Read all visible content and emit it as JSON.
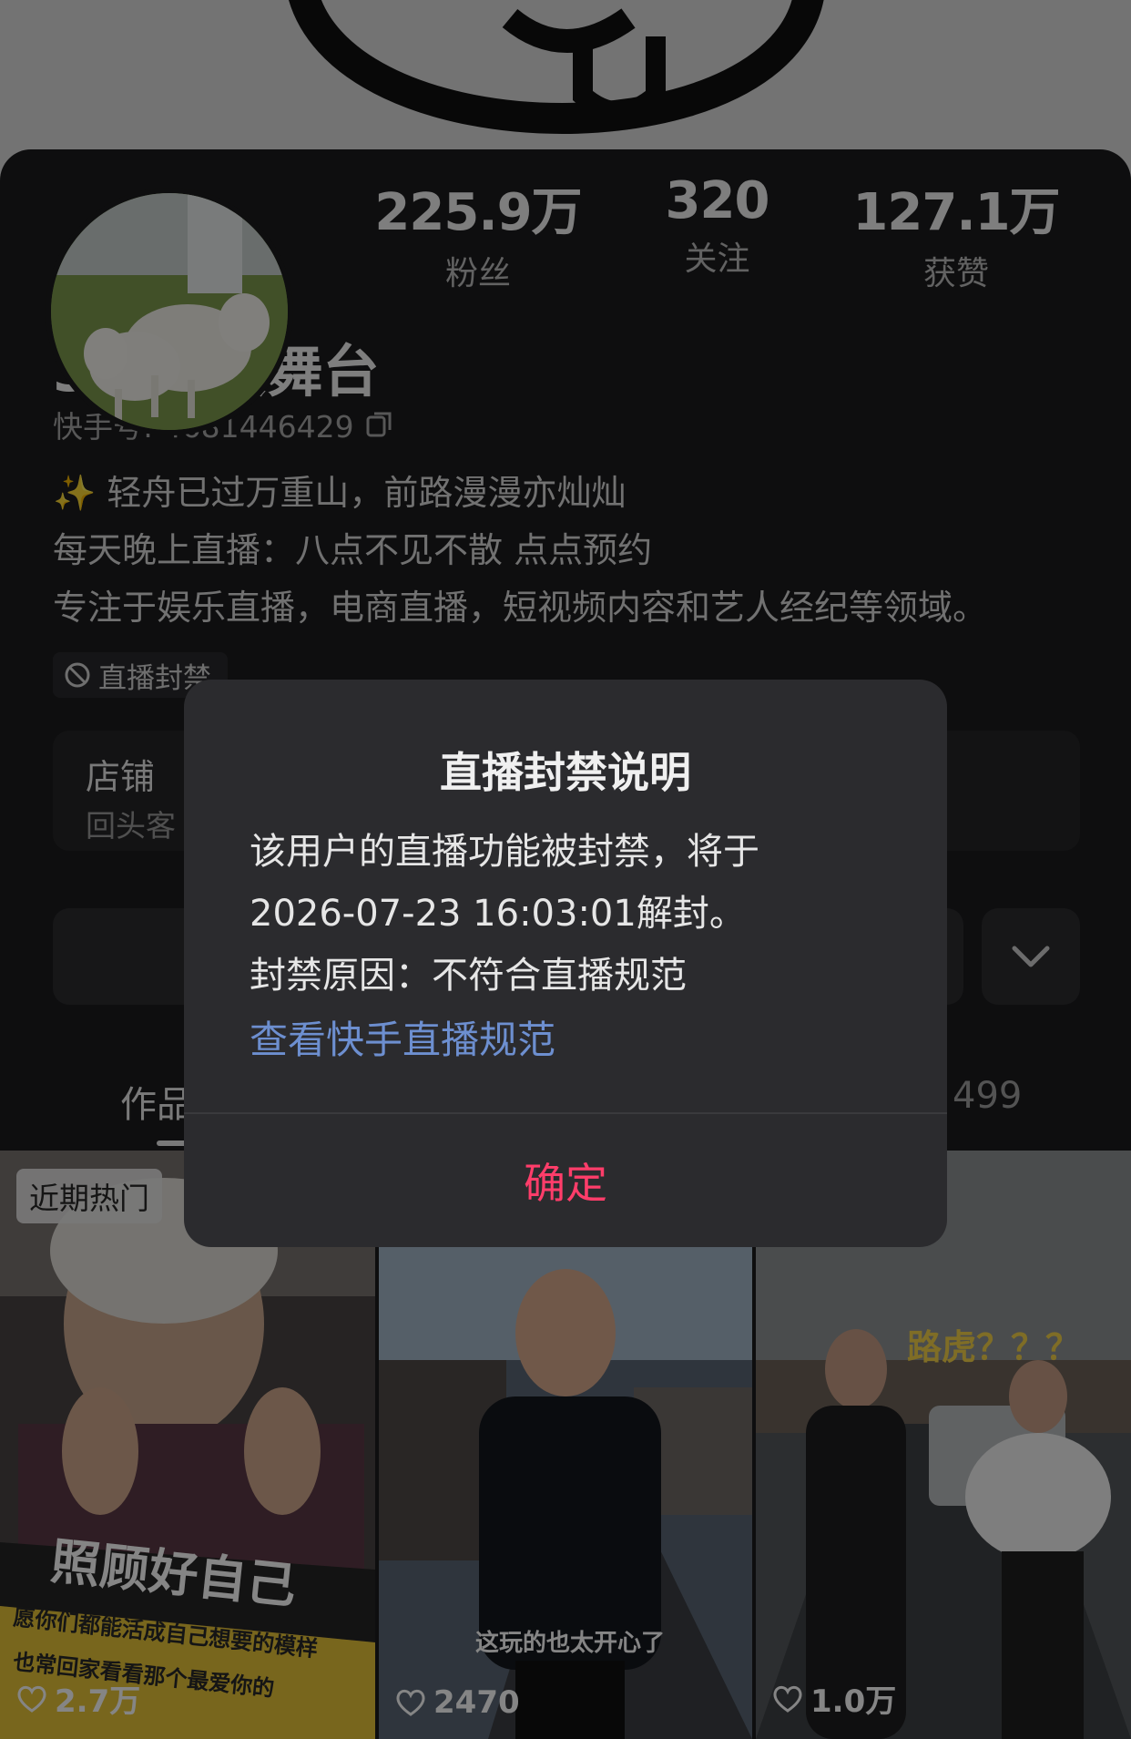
{
  "profile": {
    "name": "3484大舞台",
    "kuaishou_id_label": "快手号: 4681446429",
    "bio_lines": [
      "✨ 轻舟已过万重山，前路漫漫亦灿灿",
      "每天晚上直播：八点不见不散 点点预约",
      "专注于娱乐直播，电商直播，短视频内容和艺人经纪等领域。"
    ],
    "ban_tag": "直播封禁"
  },
  "stats": [
    {
      "value": "225.9万",
      "label": "粉丝"
    },
    {
      "value": "320",
      "label": "关注"
    },
    {
      "value": "127.1万",
      "label": "获赞"
    }
  ],
  "shop": {
    "title": "店铺",
    "subtitle": "回头客"
  },
  "tabs": {
    "works_label": "作品",
    "count_label": "499"
  },
  "videos": [
    {
      "badge": "近期热门",
      "caption": "照顾好自己",
      "sub_caption": "愿你们都能活成自己想要的模样",
      "sub_caption2": "也常回家看看那个最爱你的",
      "likes": "2.7万"
    },
    {
      "caption": "这玩的也太开心了",
      "likes": "2470"
    },
    {
      "caption": "路虎？？？",
      "likes": "1.0万"
    }
  ],
  "dialog": {
    "title": "直播封禁说明",
    "line1": "该用户的直播功能被封禁，将于",
    "line2": "2026-07-23 16:03:01解封。",
    "line3": "封禁原因：不符合直播规范",
    "link": "查看快手直播规范",
    "confirm": "确定"
  },
  "colors": {
    "link": "#6d8fd0",
    "confirm": "#ff3d6a",
    "background": "#1b1b1d"
  }
}
